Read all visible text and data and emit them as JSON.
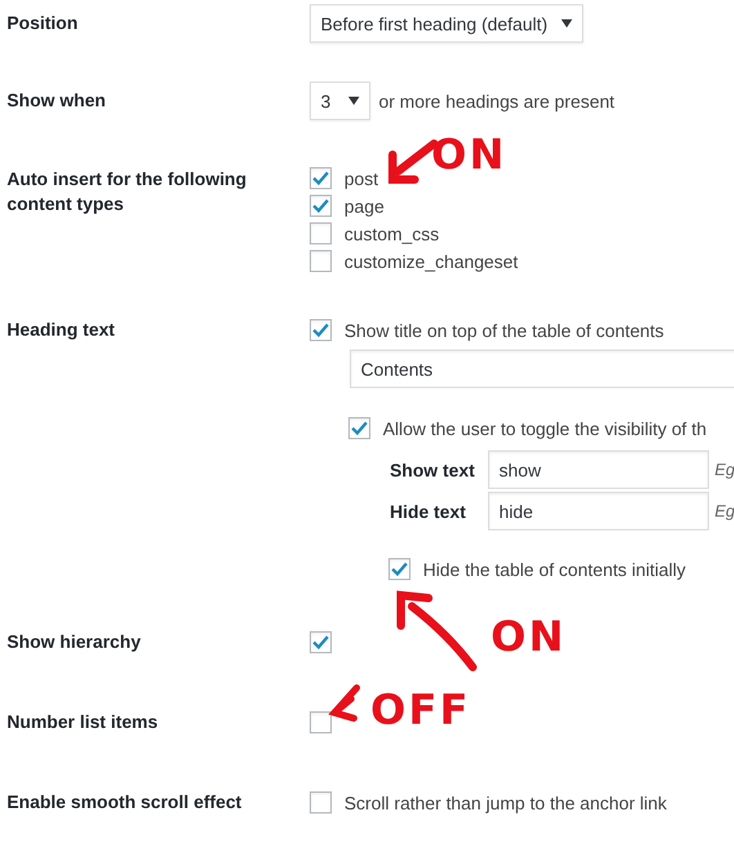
{
  "settings": [
    {
      "kind": "select",
      "label": "Position",
      "value": "Before first heading (default)"
    },
    {
      "kind": "select_suffix",
      "label": "Show when",
      "value": "3",
      "suffix": "or more headings are present"
    },
    {
      "kind": "checklist",
      "label": "Auto insert for the following content types",
      "options": [
        {
          "label": "post",
          "checked": true
        },
        {
          "label": "page",
          "checked": true
        },
        {
          "label": "custom_css",
          "checked": false
        },
        {
          "label": "customize_changeset",
          "checked": false
        }
      ]
    },
    {
      "kind": "heading",
      "label": "Heading text",
      "show_title": {
        "label": "Show title on top of the table of contents",
        "checked": true
      },
      "title_value": "Contents",
      "toggle": {
        "label": "Allow the user to toggle the visibility of th",
        "checked": true
      },
      "fields": [
        {
          "label": "Show text",
          "value": "show",
          "hint": "Eg"
        },
        {
          "label": "Hide text",
          "value": "hide",
          "hint": "Eg"
        }
      ],
      "initial": {
        "label": "Hide the table of contents initially",
        "checked": true
      }
    },
    {
      "kind": "checkbox",
      "label": "Show hierarchy",
      "checked": true
    },
    {
      "kind": "checkbox",
      "label": "Number list items",
      "checked": false
    },
    {
      "kind": "checkbox",
      "label": "Enable smooth scroll effect",
      "checked": false,
      "text": "Scroll rather than jump to the anchor link"
    }
  ],
  "annotations": [
    {
      "text": "ON"
    },
    {
      "text": "ON"
    },
    {
      "text": "OFF"
    }
  ]
}
